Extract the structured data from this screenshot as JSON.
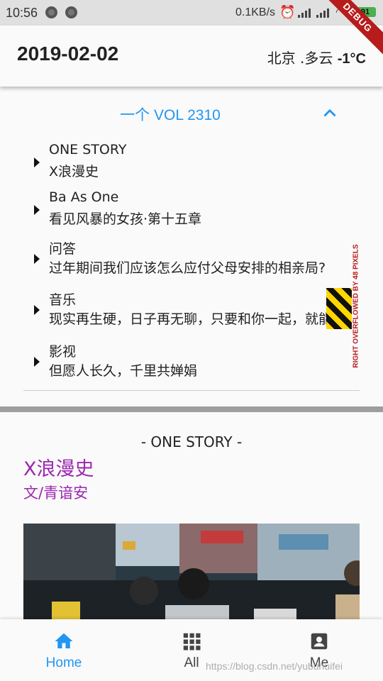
{
  "status": {
    "time": "10:56",
    "network_speed": "0.1KB/s",
    "battery": "91",
    "debug_label": "DEBUG"
  },
  "header": {
    "date": "2019-02-02",
    "weather_place": "北京 .多云 ",
    "weather_temp": "-1°C"
  },
  "menu": {
    "vol_prefix": "一个 ",
    "vol_number": "VOL 2310",
    "items": [
      {
        "category": "ONE STORY",
        "title": "X浪漫史"
      },
      {
        "category": "Ba As One",
        "title": "看见风暴的女孩·第十五章"
      },
      {
        "category": " 问答",
        "title": "过年期间我们应该怎么应付父母安排的相亲局?"
      },
      {
        "category": " 音乐",
        "title": "现实再生硬，日子再无聊，只要和你一起，就能"
      },
      {
        "category": " 影视",
        "title": "但愿人长久，千里共婵娟"
      }
    ],
    "overflow_warning": "RIGHT OVERFLOWED BY 48 PIXELS"
  },
  "story": {
    "label": "- ONE STORY -",
    "title": "X浪漫史",
    "author": "文/青谙安"
  },
  "bottom_nav": {
    "items": [
      {
        "label": "Home",
        "icon": "home-icon",
        "active": true
      },
      {
        "label": "All",
        "icon": "grid-icon",
        "active": false
      },
      {
        "label": "Me",
        "icon": "account-box-icon",
        "active": false
      }
    ],
    "active_color": "#2196f3",
    "inactive_color": "#444444"
  },
  "watermark": "https://blog.csdn.net/yubuhuifei",
  "colors": {
    "accent_blue": "#2196f3",
    "story_purple": "#9c27b0"
  }
}
